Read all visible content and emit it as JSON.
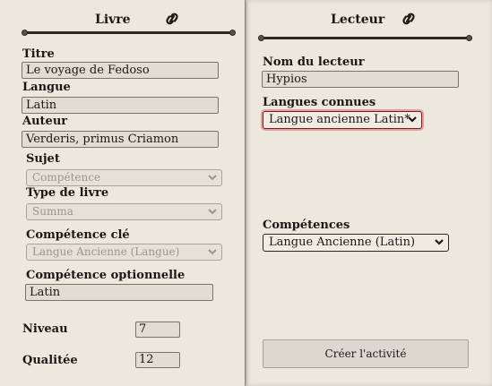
{
  "book": {
    "title": "Livre",
    "title_label": "Titre",
    "title_value": "Le voyage de Fedoso",
    "language_label": "Langue",
    "language_value": "Latin",
    "author_label": "Auteur",
    "author_value": "Verderis, primus Criamon",
    "subject_label": "Sujet",
    "subject_value": "Compétence",
    "book_type_label": "Type de livre",
    "book_type_value": "Summa",
    "key_skill_label": "Compétence clé",
    "key_skill_value": "Langue Ancienne (Langue)",
    "optional_skill_label": "Compétence optionnelle",
    "optional_skill_value": "Latin",
    "level_label": "Niveau",
    "level_value": "7",
    "quality_label": "Qualitée",
    "quality_value": "12"
  },
  "reader": {
    "title": "Lecteur",
    "name_label": "Nom du lecteur",
    "name_value": "Hypios",
    "languages_label": "Langues connues",
    "languages_value": "Langue ancienne Latin*",
    "skills_label": "Compétences",
    "skills_value": "Langue Ancienne (Latin)",
    "create_button": "Créer l'activité"
  },
  "icons": {
    "link": "chain-link-icon",
    "chevron": "chevron-down-icon"
  },
  "colors": {
    "panel": "#ece8de",
    "ink": "#191813",
    "focus_ring": "#e2a0a0"
  }
}
